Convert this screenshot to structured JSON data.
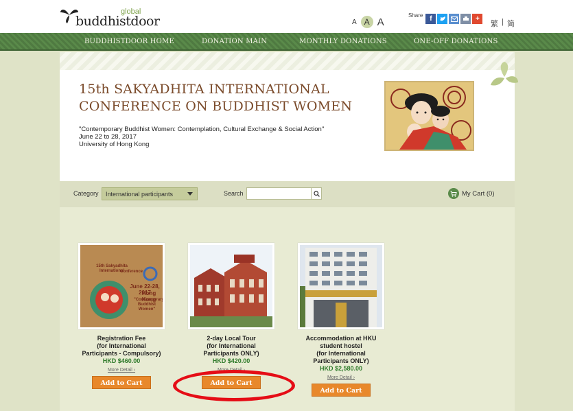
{
  "header": {
    "brand_name": "buddhistdoor",
    "brand_sub": "global",
    "font_small": "A",
    "font_mid": "A",
    "font_large": "A",
    "share_label": "Share",
    "share_icons": [
      "facebook-icon",
      "twitter-icon",
      "email-icon",
      "print-icon",
      "more-share-icon"
    ],
    "lang_trad": "繁",
    "lang_sep": "|",
    "lang_simp": "简"
  },
  "nav": {
    "items": [
      "BUDDHISTDOOR HOME",
      "DONATION MAIN",
      "MONTHLY DONATIONS",
      "ONE-OFF DONATIONS"
    ]
  },
  "hero": {
    "title_line1": "15th SAKYADHITA INTERNATIONAL",
    "title_line2": "CONFERENCE ON BUDDHIST WOMEN",
    "subtitle": "\"Contemporary Buddhist Women: Contemplation, Cultural Exchange & Social Action\"",
    "dates": "June 22 to 28, 2017",
    "venue": "University of Hong Kong"
  },
  "filter": {
    "category_label": "Category",
    "category_value": "International participants",
    "search_label": "Search",
    "search_value": "",
    "cart_label": "My Cart (0)"
  },
  "products": [
    {
      "name_lines": [
        "Registration Fee",
        "(for International",
        "Participants - Compulsory)"
      ],
      "price": "HKD $460.00",
      "more": "More Detail ›",
      "button": "Add to Cart",
      "thumb_text": [
        "15th Sakyadhita International",
        "Conference",
        "June 22-28, 2017",
        "Hong Kong",
        "\"Contemporary",
        "Buddhist Women\""
      ]
    },
    {
      "name_lines": [
        "2-day Local Tour",
        "(for International",
        "Participants ONLY)"
      ],
      "price": "HKD $420.00",
      "more": "More Detail ›",
      "button": "Add to Cart"
    },
    {
      "name_lines": [
        "Accommodation at HKU",
        "student hostel",
        "(for International",
        "Participants ONLY)"
      ],
      "price": "HKD $2,580.00",
      "more": "More Detail ›",
      "button": "Add to Cart"
    }
  ],
  "colors": {
    "nav_green": "#5a8a4a",
    "title_brown": "#7a4a2a",
    "price_green": "#2e7a2a",
    "button_orange": "#e8882b",
    "highlight_red": "#e50d16"
  }
}
